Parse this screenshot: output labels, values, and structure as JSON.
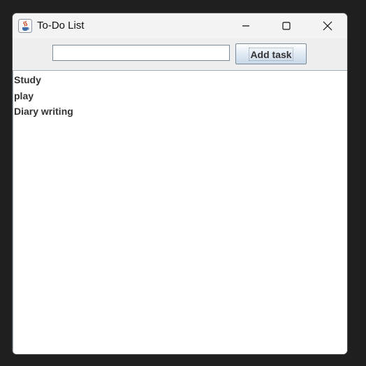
{
  "window": {
    "title": "To-Do List",
    "controls": [
      "minimize-icon",
      "maximize-icon",
      "close-icon"
    ]
  },
  "toolbar": {
    "task_input_value": "",
    "add_button_label": "Add task"
  },
  "tasks": [
    "Study",
    "play",
    "Diary writing"
  ],
  "colors": {
    "desktop": "#1f1f1f",
    "titlebar": "#f3f3f3",
    "toolbar": "#eeeeee",
    "list_background": "#ffffff",
    "task_text": "#333333"
  }
}
